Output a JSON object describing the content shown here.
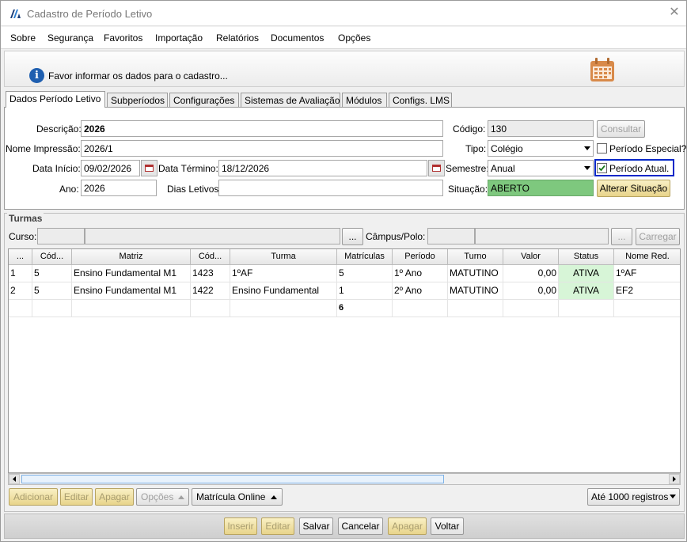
{
  "window": {
    "title": "Cadastro de Período Letivo"
  },
  "menu": [
    "Sobre",
    "Segurança",
    "Favoritos",
    "Importação",
    "Relatórios",
    "Documentos",
    "Opções"
  ],
  "info": {
    "text": "Favor informar os dados para o cadastro..."
  },
  "tabs": [
    "Dados Período Letivo",
    "Subperíodos",
    "Configurações",
    "Sistemas de Avaliação",
    "Módulos",
    "Configs. LMS"
  ],
  "form": {
    "descricao_label": "Descrição:",
    "descricao": "2026",
    "nome_impressao_label": "Nome Impressão:",
    "nome_impressao": "2026/1",
    "data_inicio_label": "Data Início:",
    "data_inicio": "09/02/2026",
    "data_termino_label": "Data Término:",
    "data_termino": "18/12/2026",
    "ano_label": "Ano:",
    "ano": "2026",
    "dias_letivos_label": "Dias Letivos",
    "codigo_label": "Código:",
    "codigo": "130",
    "consultar_label": "Consultar",
    "tipo_label": "Tipo:",
    "tipo": "Colégio",
    "periodo_especial_label": "Período Especial?",
    "semestre_label": "Semestre:",
    "semestre": "Anual",
    "periodo_atual_label": "Período Atual.",
    "situacao_label": "Situação:",
    "situacao": "ABERTO",
    "alterar_situacao_label": "Alterar Situação",
    "situacao_color": "#7ec87e"
  },
  "turmas": {
    "title": "Turmas",
    "curso_label": "Curso:",
    "campus_label": "Câmpus/Polo:",
    "ellipsis": "...",
    "carregar_label": "Carregar",
    "columns": [
      "...",
      "Cód...",
      "Matriz",
      "Cód...",
      "Turma",
      "Matrículas",
      "Período",
      "Turno",
      "Valor",
      "Status",
      "Nome Red."
    ],
    "rows": [
      [
        "1",
        "5",
        "Ensino Fundamental M1",
        "1423",
        "1ºAF",
        "5",
        "1º Ano",
        "MATUTINO",
        "0,00",
        "ATIVA",
        "1ºAF"
      ],
      [
        "2",
        "5",
        "Ensino Fundamental M1",
        "1422",
        "Ensino Fundamental",
        "1",
        "2º Ano",
        "MATUTINO",
        "0,00",
        "ATIVA",
        "EF2"
      ]
    ],
    "total_matriculas": "6",
    "status_color": "#d7f5d7"
  },
  "grid_actions": {
    "adicionar": "Adicionar",
    "editar": "Editar",
    "apagar": "Apagar",
    "opcoes": "Opções",
    "matricula_online": "Matrícula Online",
    "registros": "Até 1000 registros"
  },
  "footer": {
    "inserir": "Inserir",
    "editar": "Editar",
    "salvar": "Salvar",
    "cancelar": "Cancelar",
    "apagar": "Apagar",
    "voltar": "Voltar"
  }
}
